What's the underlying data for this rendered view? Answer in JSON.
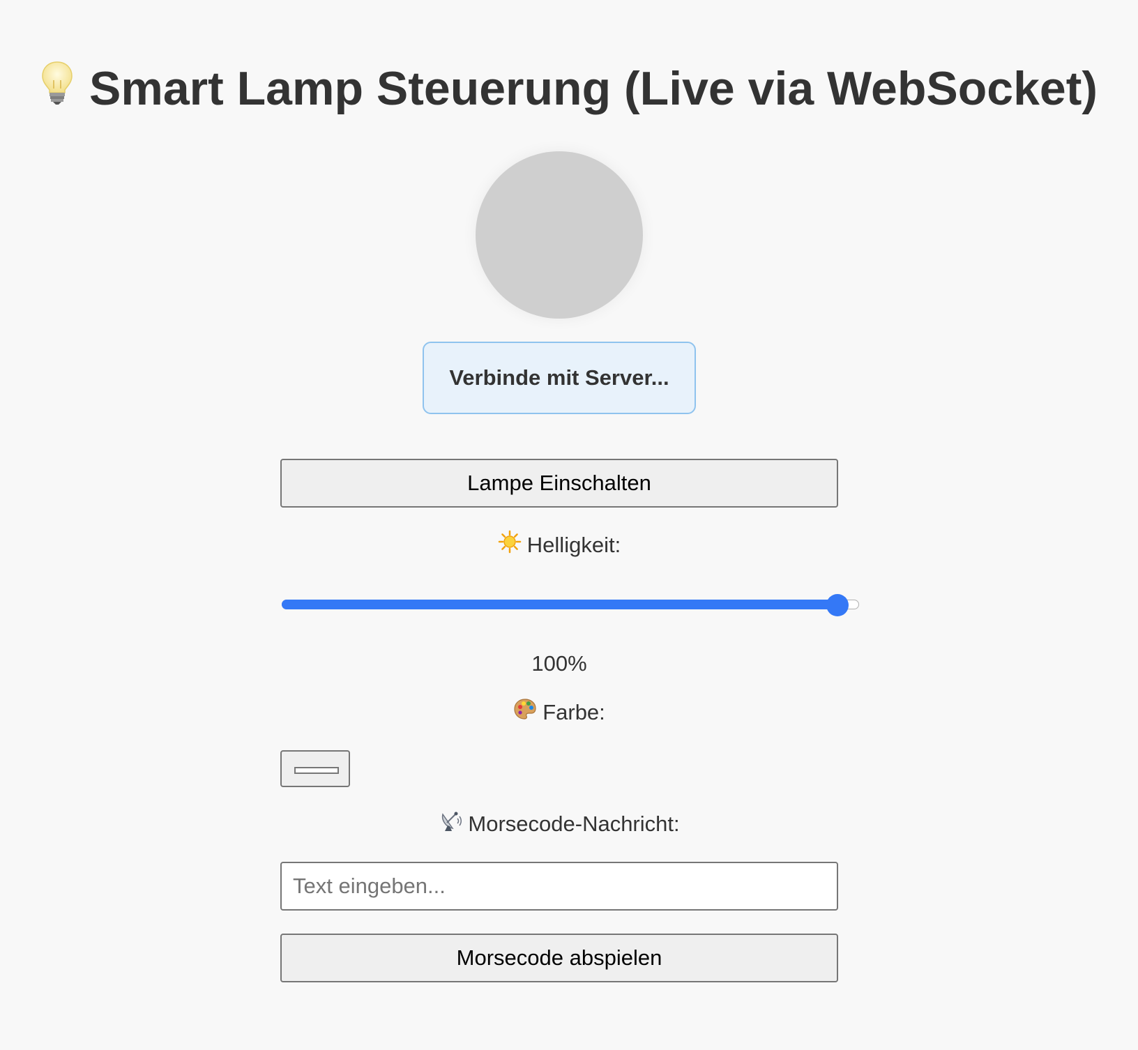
{
  "header": {
    "icon": "light-bulb-icon",
    "title": "Smart Lamp Steuerung (Live via WebSocket)"
  },
  "lamp": {
    "state": "off",
    "color": "#cfcfcf"
  },
  "status": {
    "text": "Verbinde mit Server..."
  },
  "toggle_button": {
    "label": "Lampe Einschalten"
  },
  "brightness": {
    "icon": "sun-icon",
    "label": "Helligkeit:",
    "value": 100,
    "max": 100,
    "value_text": "100%"
  },
  "color": {
    "icon": "palette-icon",
    "label": "Farbe:",
    "value": "#ffffff"
  },
  "morse": {
    "icon": "satellite-antenna-icon",
    "label": "Morsecode-Nachricht:",
    "placeholder": "Text eingeben...",
    "value": "",
    "button_label": "Morsecode abspielen"
  },
  "colors": {
    "background": "#f8f8f8",
    "accent": "#3478f6",
    "status_bg": "#e8f2fb",
    "status_border": "#8fc3ee"
  }
}
